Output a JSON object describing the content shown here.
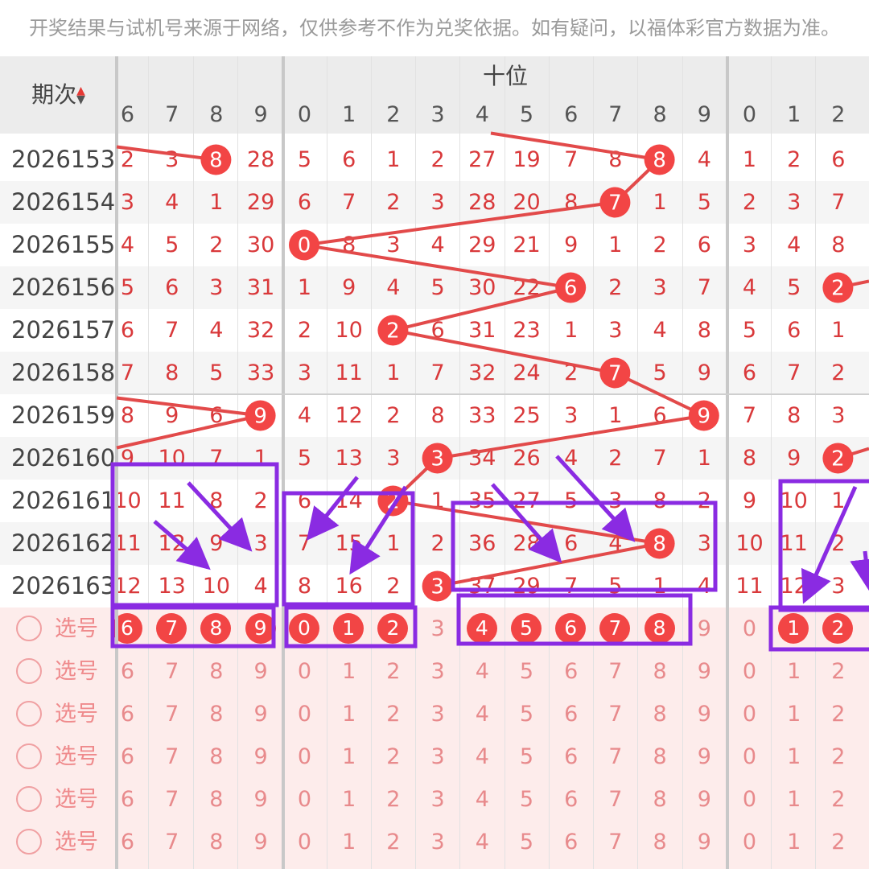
{
  "notice": "开奖结果与试机号来源于网络，仅供参考不作为兑奖依据。如有疑问，以福体彩官方数据为准。",
  "header": {
    "period_label": "期次",
    "group_label": "十位",
    "left_digits": [
      "6",
      "7",
      "8",
      "9"
    ],
    "mid_digits": [
      "0",
      "1",
      "2",
      "3",
      "4",
      "5",
      "6",
      "7",
      "8",
      "9"
    ],
    "right_digits": [
      "0",
      "1",
      "2"
    ]
  },
  "rows": [
    {
      "period": "2026153",
      "left": [
        "2",
        "3",
        "8",
        "28"
      ],
      "mid": [
        "5",
        "6",
        "1",
        "2",
        "27",
        "19",
        "7",
        "8",
        "8",
        "4"
      ],
      "right": [
        "1",
        "2",
        "6"
      ]
    },
    {
      "period": "2026154",
      "left": [
        "3",
        "4",
        "1",
        "29"
      ],
      "mid": [
        "6",
        "7",
        "2",
        "3",
        "28",
        "20",
        "8",
        "7",
        "1",
        "5"
      ],
      "right": [
        "2",
        "3",
        "7"
      ]
    },
    {
      "period": "2026155",
      "left": [
        "4",
        "5",
        "2",
        "30"
      ],
      "mid": [
        "0",
        "8",
        "3",
        "4",
        "29",
        "21",
        "9",
        "1",
        "2",
        "6"
      ],
      "right": [
        "3",
        "4",
        "8"
      ]
    },
    {
      "period": "2026156",
      "left": [
        "5",
        "6",
        "3",
        "31"
      ],
      "mid": [
        "1",
        "9",
        "4",
        "5",
        "30",
        "22",
        "6",
        "2",
        "3",
        "7"
      ],
      "right": [
        "4",
        "5",
        "2"
      ]
    },
    {
      "period": "2026157",
      "left": [
        "6",
        "7",
        "4",
        "32"
      ],
      "mid": [
        "2",
        "10",
        "2",
        "6",
        "31",
        "23",
        "1",
        "3",
        "4",
        "8"
      ],
      "right": [
        "5",
        "6",
        "1"
      ]
    },
    {
      "period": "2026158",
      "left": [
        "7",
        "8",
        "5",
        "33"
      ],
      "mid": [
        "3",
        "11",
        "1",
        "7",
        "32",
        "24",
        "2",
        "7",
        "5",
        "9"
      ],
      "right": [
        "6",
        "7",
        "2"
      ]
    },
    {
      "period": "2026159",
      "left": [
        "8",
        "9",
        "6",
        "9"
      ],
      "mid": [
        "4",
        "12",
        "2",
        "8",
        "33",
        "25",
        "3",
        "1",
        "6",
        "9"
      ],
      "right": [
        "7",
        "8",
        "3"
      ]
    },
    {
      "period": "2026160",
      "left": [
        "9",
        "10",
        "7",
        "1"
      ],
      "mid": [
        "5",
        "13",
        "3",
        "3",
        "34",
        "26",
        "4",
        "2",
        "7",
        "1"
      ],
      "right": [
        "8",
        "9",
        "2"
      ]
    },
    {
      "period": "2026161",
      "left": [
        "10",
        "11",
        "8",
        "2"
      ],
      "mid": [
        "6",
        "14",
        "2",
        "1",
        "35",
        "27",
        "5",
        "3",
        "8",
        "2"
      ],
      "right": [
        "9",
        "10",
        "1"
      ]
    },
    {
      "period": "2026162",
      "left": [
        "11",
        "12",
        "9",
        "3"
      ],
      "mid": [
        "7",
        "15",
        "1",
        "2",
        "36",
        "28",
        "6",
        "4",
        "8",
        "3"
      ],
      "right": [
        "10",
        "11",
        "2"
      ]
    },
    {
      "period": "2026163",
      "left": [
        "12",
        "13",
        "10",
        "4"
      ],
      "mid": [
        "8",
        "16",
        "2",
        "3",
        "37",
        "29",
        "7",
        "5",
        "1",
        "4"
      ],
      "right": [
        "11",
        "12",
        "3"
      ]
    }
  ],
  "draw_balls": [
    {
      "row": 0,
      "col": "L2"
    },
    {
      "row": 0,
      "col": "M8"
    },
    {
      "row": 1,
      "col": "M7"
    },
    {
      "row": 2,
      "col": "M0"
    },
    {
      "row": 3,
      "col": "M6"
    },
    {
      "row": 3,
      "col": "R2"
    },
    {
      "row": 4,
      "col": "M2"
    },
    {
      "row": 5,
      "col": "M7"
    },
    {
      "row": 6,
      "col": "L3"
    },
    {
      "row": 6,
      "col": "M9"
    },
    {
      "row": 7,
      "col": "M3"
    },
    {
      "row": 7,
      "col": "R2"
    },
    {
      "row": 8,
      "col": "M2"
    },
    {
      "row": 9,
      "col": "M8"
    },
    {
      "row": 10,
      "col": "M3"
    }
  ],
  "selection_row": {
    "label": "选号",
    "left": [
      "6",
      "7",
      "8",
      "9"
    ],
    "mid": [
      "0",
      "1",
      "2",
      "3",
      "4",
      "5",
      "6",
      "7",
      "8",
      "9"
    ],
    "right": [
      "0",
      "1",
      "2"
    ],
    "selected_left": [
      "6",
      "7",
      "8",
      "9"
    ],
    "selected_mid": [
      "0",
      "1",
      "2",
      "4",
      "5",
      "6",
      "7",
      "8"
    ],
    "selected_right": [
      "1",
      "2"
    ]
  },
  "pick_rows": [
    {
      "label": "选号",
      "left": [
        "6",
        "7",
        "8",
        "9"
      ],
      "mid": [
        "0",
        "1",
        "2",
        "3",
        "4",
        "5",
        "6",
        "7",
        "8",
        "9"
      ],
      "right": [
        "0",
        "1",
        "2"
      ]
    },
    {
      "label": "选号",
      "left": [
        "6",
        "7",
        "8",
        "9"
      ],
      "mid": [
        "0",
        "1",
        "2",
        "3",
        "4",
        "5",
        "6",
        "7",
        "8",
        "9"
      ],
      "right": [
        "0",
        "1",
        "2"
      ]
    },
    {
      "label": "选号",
      "left": [
        "6",
        "7",
        "8",
        "9"
      ],
      "mid": [
        "0",
        "1",
        "2",
        "3",
        "4",
        "5",
        "6",
        "7",
        "8",
        "9"
      ],
      "right": [
        "0",
        "1",
        "2"
      ]
    },
    {
      "label": "选号",
      "left": [
        "6",
        "7",
        "8",
        "9"
      ],
      "mid": [
        "0",
        "1",
        "2",
        "3",
        "4",
        "5",
        "6",
        "7",
        "8",
        "9"
      ],
      "right": [
        "0",
        "1",
        "2"
      ]
    },
    {
      "label": "选号",
      "left": [
        "6",
        "7",
        "8",
        "9"
      ],
      "mid": [
        "0",
        "1",
        "2",
        "3",
        "4",
        "5",
        "6",
        "7",
        "8",
        "9"
      ],
      "right": [
        "0",
        "1",
        "2"
      ]
    }
  ],
  "colors": {
    "ball": "#f24545",
    "line": "#e24a4a",
    "annotation": "#8a2be2",
    "pick_bg": "#fdeceb"
  }
}
